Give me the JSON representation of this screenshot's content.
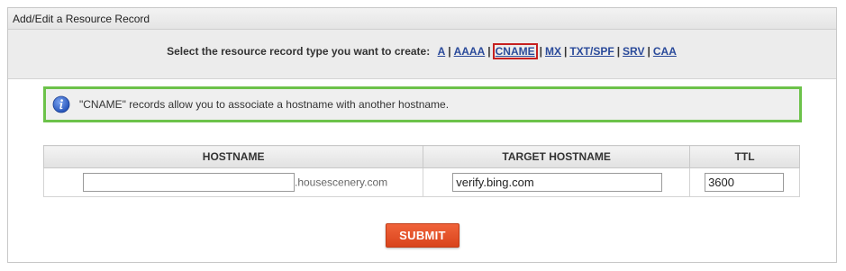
{
  "panel": {
    "title": "Add/Edit a Resource Record"
  },
  "type_selector": {
    "prompt": "Select the resource record type you want to create:",
    "types": [
      "A",
      "AAAA",
      "CNAME",
      "MX",
      "TXT/SPF",
      "SRV",
      "CAA"
    ],
    "selected": "CNAME",
    "separator": "|"
  },
  "info": {
    "icon": "info-icon",
    "message": "\"CNAME\" records allow you to associate a hostname with another hostname."
  },
  "table": {
    "headers": {
      "hostname": "HOSTNAME",
      "target": "TARGET HOSTNAME",
      "ttl": "TTL"
    },
    "row": {
      "hostname_value": "",
      "hostname_suffix": ".housescenery.com",
      "target_value": "verify.bing.com",
      "ttl_value": "3600"
    }
  },
  "actions": {
    "submit_label": "SUBMIT"
  },
  "colors": {
    "accent_green": "#6cc24a",
    "submit_orange": "#e8532a",
    "link_blue": "#2a4a9a",
    "selected_border": "#c62020"
  }
}
